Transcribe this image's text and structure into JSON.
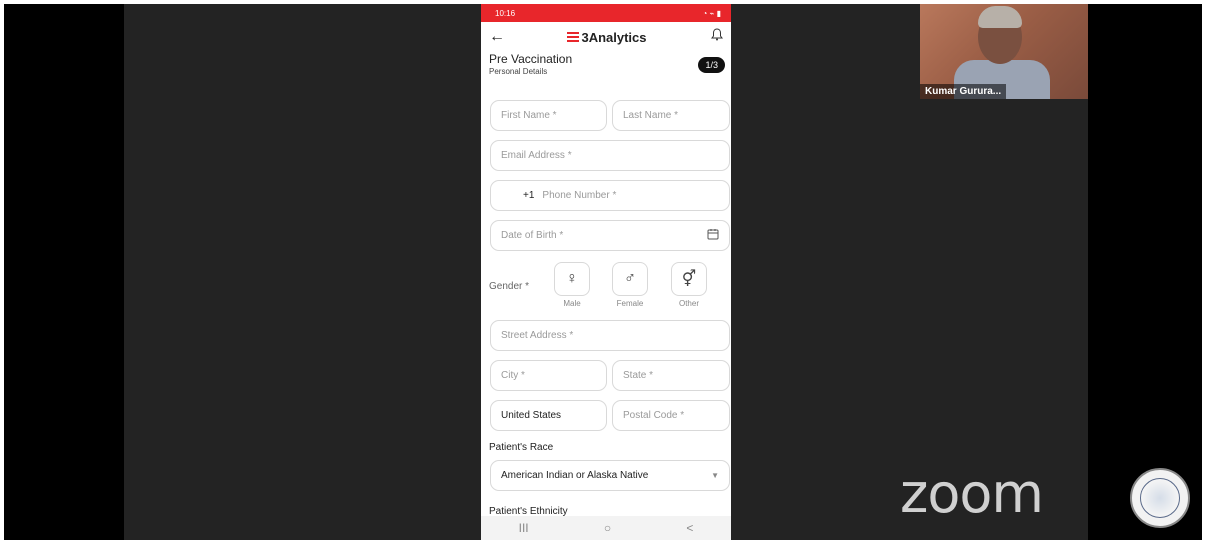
{
  "status_bar": {
    "time": "10:16",
    "icons_right": "◔ ⌁ ▮"
  },
  "header": {
    "back_icon": "arrow-left-icon",
    "brand": "3Analytics",
    "bell_icon": "bell-icon"
  },
  "page": {
    "title": "Pre Vaccination",
    "subtitle": "Personal Details",
    "step": "1/3"
  },
  "form": {
    "first_name": {
      "placeholder": "First Name *"
    },
    "last_name": {
      "placeholder": "Last Name *"
    },
    "email": {
      "placeholder": "Email Address *"
    },
    "phone": {
      "code": "+1",
      "placeholder": "Phone Number *"
    },
    "dob": {
      "placeholder": "Date of Birth *"
    },
    "gender": {
      "label": "Gender *",
      "options": [
        {
          "label": "Male",
          "symbol": "♀"
        },
        {
          "label": "Female",
          "symbol": "♂"
        },
        {
          "label": "Other",
          "symbol": "⚥"
        }
      ]
    },
    "street": {
      "placeholder": "Street Address *"
    },
    "city": {
      "placeholder": "City *"
    },
    "state": {
      "placeholder": "State *"
    },
    "country": {
      "value": "United States"
    },
    "postal": {
      "placeholder": "Postal Code *"
    },
    "race": {
      "label": "Patient's Race",
      "value": "American Indian or Alaska Native"
    },
    "ethnicity": {
      "label": "Patient's Ethnicity"
    }
  },
  "nav": {
    "recent": "III",
    "home": "○",
    "back": "<"
  },
  "video": {
    "participant_name": "Kumar Gurura..."
  },
  "branding": {
    "zoom": "zoom"
  },
  "colors": {
    "accent": "#e8262b",
    "background": "#232323"
  }
}
